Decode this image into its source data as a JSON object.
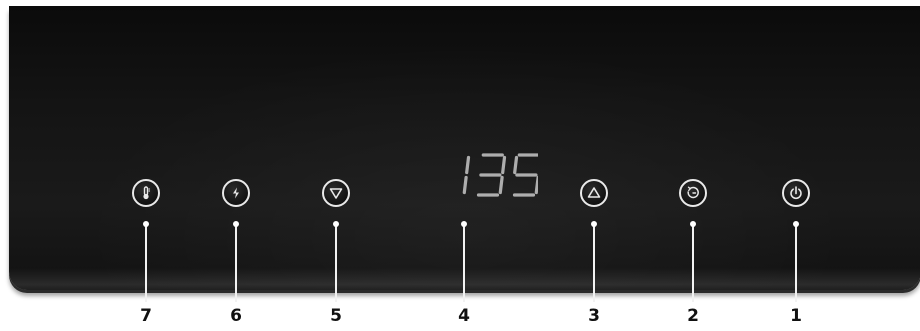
{
  "colors": {
    "panel": "#141414",
    "key_ring": "#e9e9e9",
    "display_segments": "#c7c7c7",
    "badge_bg": "#ffffff",
    "badge_text": "#111111"
  },
  "display": {
    "readout": "135"
  },
  "controls": [
    {
      "number": "7",
      "icon": "temperature-icon"
    },
    {
      "number": "6",
      "icon": "power-boost-icon"
    },
    {
      "number": "5",
      "icon": "decrease-icon"
    },
    {
      "number": "4",
      "icon": "display"
    },
    {
      "number": "3",
      "icon": "increase-icon"
    },
    {
      "number": "2",
      "icon": "timer-icon"
    },
    {
      "number": "1",
      "icon": "power-icon"
    }
  ]
}
